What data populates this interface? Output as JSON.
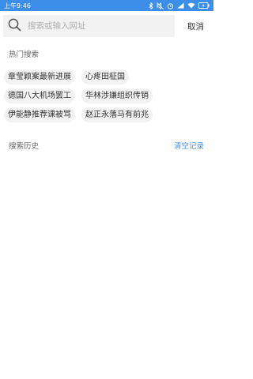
{
  "status_bar": {
    "time": "上午9:46",
    "icons": [
      "bluetooth-icon",
      "mute-icon",
      "alarm-icon",
      "signal-icon",
      "wifi-icon",
      "battery-charging-icon"
    ]
  },
  "search": {
    "placeholder": "搜索或输入网址",
    "value": "",
    "cancel_label": "取消"
  },
  "hot_search": {
    "title": "热门搜索",
    "tags": [
      "章莹颖案最新进展",
      "心疼田柾国",
      "德国八大机场罢工",
      "华林涉嫌组织传销",
      "伊能静推荐课被骂",
      "赵正永落马有前兆"
    ]
  },
  "history": {
    "title": "搜索历史",
    "clear_label": "清空记录"
  },
  "colors": {
    "accent": "#3d8ee8",
    "tag_bg": "#f2f2f2",
    "search_bg": "#f2f2f2"
  }
}
